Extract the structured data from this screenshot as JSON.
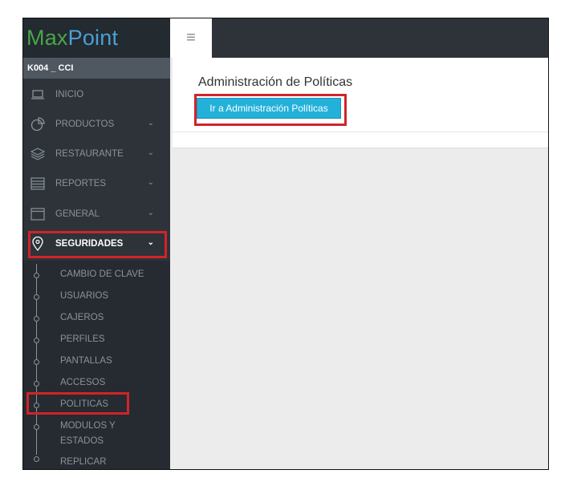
{
  "brand": {
    "part1": "Max",
    "part2": "Point"
  },
  "store_code": "K004 _ CCI",
  "menu": [
    {
      "label": "INICIO",
      "icon": "monitor-icon",
      "chevron": false
    },
    {
      "label": "PRODUCTOS",
      "icon": "pie-chart-icon",
      "chevron": true
    },
    {
      "label": "RESTAURANTE",
      "icon": "layers-icon",
      "chevron": true
    },
    {
      "label": "REPORTES",
      "icon": "list-icon",
      "chevron": true
    },
    {
      "label": "GENERAL",
      "icon": "window-icon",
      "chevron": true
    },
    {
      "label": "SEGURIDADES",
      "icon": "map-pin-icon",
      "chevron": true,
      "active": true
    }
  ],
  "submenu": [
    "CAMBIO DE CLAVE",
    "USUARIOS",
    "CAJEROS",
    "PERFILES",
    "PANTALLAS",
    "ACCESOS",
    "POLITICAS",
    "MODULOS Y",
    "ESTADOS",
    "REPLICAR"
  ],
  "main": {
    "title": "Administración de Políticas",
    "button_label": "Ir a Administración Políticas"
  },
  "colors": {
    "highlight": "#d2232a",
    "accent": "#23b1da",
    "sidebar": "#2d3339"
  }
}
